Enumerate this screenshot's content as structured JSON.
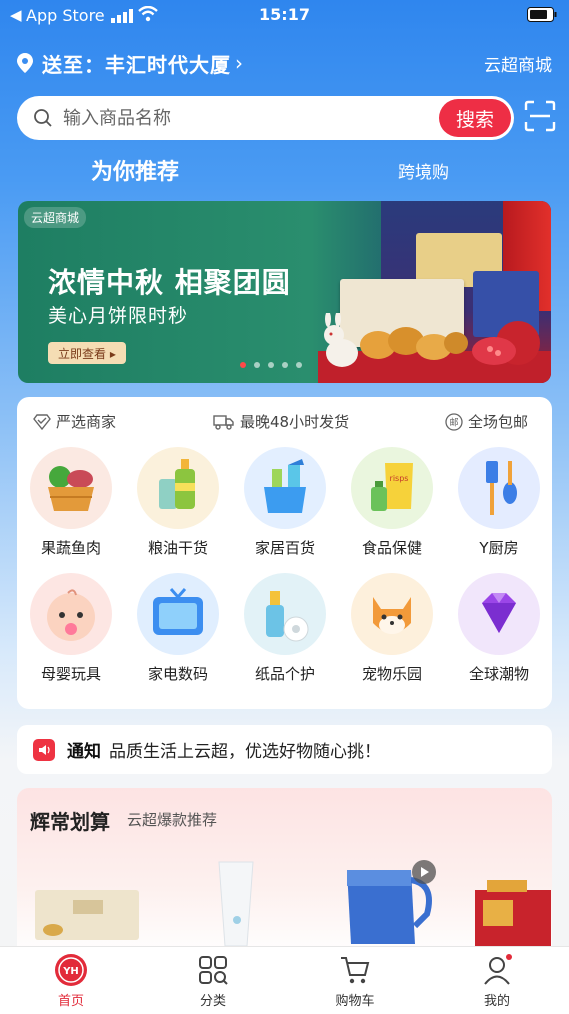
{
  "status_bar": {
    "back": "◀",
    "carrier": "App Store",
    "time": "15:17"
  },
  "location": {
    "text": "送至：丰汇时代大厦",
    "chevron": "›"
  },
  "store_name": "云超商城",
  "search": {
    "placeholder": "输入商品名称",
    "button_label": "搜索"
  },
  "tabs": [
    {
      "label": "为你推荐"
    },
    {
      "label": "跨境购"
    }
  ],
  "banner": {
    "tag": "云超商城",
    "headline": "浓情中秋 相聚团圆",
    "subheadline": "美心月饼限时秒",
    "cta": "立即查看 ▸",
    "slides": 5,
    "active_slide": 1
  },
  "perks": [
    {
      "icon": "diamond-shield-icon",
      "label": "严选商家"
    },
    {
      "icon": "truck-icon",
      "label": "最晚48小时发货"
    },
    {
      "icon": "mail-badge-icon",
      "label": "全场包邮"
    }
  ],
  "categories": [
    {
      "label": "果蔬鱼肉",
      "icon": "produce-basket-icon"
    },
    {
      "label": "粮油干货",
      "icon": "oil-bottle-icon"
    },
    {
      "label": "家居百货",
      "icon": "cleaning-bucket-icon"
    },
    {
      "label": "食品保健",
      "icon": "snack-bag-icon"
    },
    {
      "label": "Y厨房",
      "icon": "kitchen-utensils-icon"
    },
    {
      "label": "母婴玩具",
      "icon": "baby-face-icon"
    },
    {
      "label": "家电数码",
      "icon": "tv-icon"
    },
    {
      "label": "纸品个护",
      "icon": "lotion-tissue-icon"
    },
    {
      "label": "宠物乐园",
      "icon": "shiba-dog-icon"
    },
    {
      "label": "全球潮物",
      "icon": "purple-diamond-icon"
    }
  ],
  "notice": {
    "label": "通知",
    "text": "品质生活上云超，优选好物随心挑！"
  },
  "deals": {
    "title": "辉常划算",
    "subtitle": "云超爆款推荐"
  },
  "tabbar": [
    {
      "label": "首页",
      "icon": "home-yh-logo-icon",
      "active": true
    },
    {
      "label": "分类",
      "icon": "category-grid-icon",
      "active": false
    },
    {
      "label": "购物车",
      "icon": "cart-icon",
      "active": false
    },
    {
      "label": "我的",
      "icon": "profile-icon",
      "active": false
    }
  ],
  "colors": {
    "primary_red": "#ee2e45",
    "header_blue": "#2f86ee",
    "banner_green": "#1e7e62"
  }
}
